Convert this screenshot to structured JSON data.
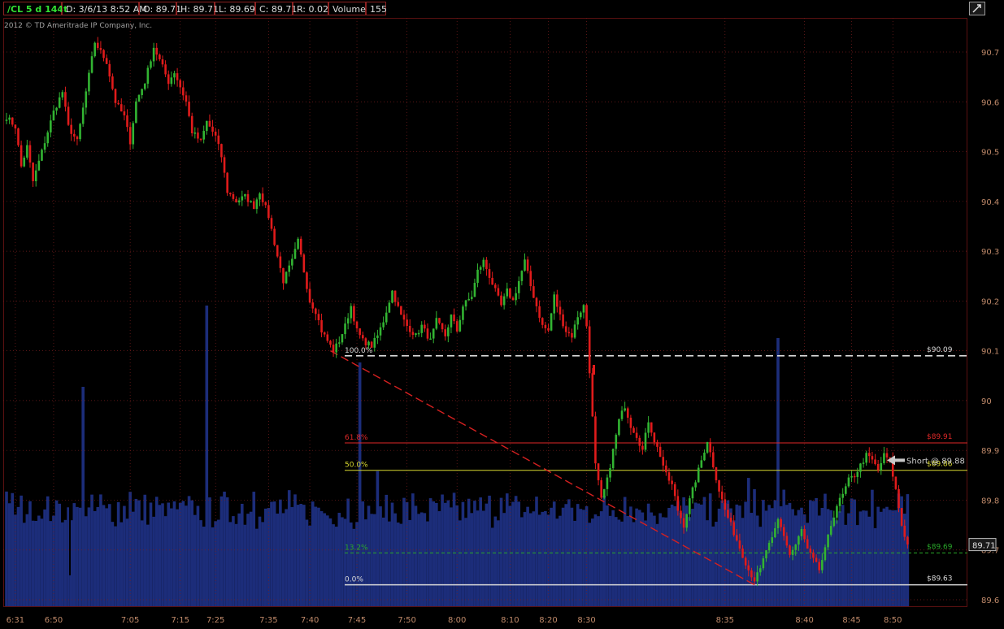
{
  "header": {
    "symbol": "/CL 5 d 144t",
    "date": "D: 3/6/13 8:52 AM",
    "open": "O: 89.71",
    "high": "H: 89.71",
    "low": "L: 89.69",
    "close": "C: 89.71",
    "range": "R: 0.02",
    "volume_label": "Volume",
    "volume_value": "155"
  },
  "copyright": "2012 © TD Ameritrade IP Company, Inc.",
  "colors": {
    "background": "#000000",
    "axis_text": "#c08a6a",
    "up": "#32b432",
    "down": "#e01b1b",
    "volume": "#1c2d7a",
    "fib_618": "#e02828",
    "fib_50": "#d8d830",
    "fib_132": "#2aa82a",
    "fib_100": "#d8d8d8",
    "trendline": "#d42020"
  },
  "chart_data": {
    "type": "candlestick",
    "y_ticks": [
      "90.7",
      "90.6",
      "90.5",
      "90.4",
      "90.3",
      "90.2",
      "90.1",
      "90",
      "89.9",
      "89.8",
      "89.7",
      "89.6"
    ],
    "ylim": [
      89.59,
      90.81
    ],
    "x_ticks": [
      "6:31",
      "6:50",
      "7:05",
      "7:15",
      "7:25",
      "7:35",
      "7:40",
      "7:45",
      "7:50",
      "8:00",
      "8:10",
      "8:20",
      "8:30",
      "8:35",
      "8:40",
      "8:45",
      "8:50"
    ],
    "x_tick_bars": [
      3,
      16,
      42,
      59,
      71,
      89,
      103,
      119,
      136,
      153,
      171,
      184,
      197,
      244,
      271,
      287,
      301
    ],
    "bar_count": 307,
    "anchors": [
      [
        0,
        90.57
      ],
      [
        3,
        90.55
      ],
      [
        5,
        90.47
      ],
      [
        7,
        90.51
      ],
      [
        9,
        90.44
      ],
      [
        13,
        90.52
      ],
      [
        16,
        90.58
      ],
      [
        19,
        90.62
      ],
      [
        21,
        90.55
      ],
      [
        24,
        90.52
      ],
      [
        27,
        90.62
      ],
      [
        30,
        90.72
      ],
      [
        34,
        90.68
      ],
      [
        37,
        90.6
      ],
      [
        40,
        90.57
      ],
      [
        42,
        90.52
      ],
      [
        44,
        90.6
      ],
      [
        47,
        90.64
      ],
      [
        50,
        90.71
      ],
      [
        53,
        90.67
      ],
      [
        55,
        90.64
      ],
      [
        57,
        90.66
      ],
      [
        59,
        90.63
      ],
      [
        61,
        90.6
      ],
      [
        63,
        90.54
      ],
      [
        66,
        90.52
      ],
      [
        68,
        90.56
      ],
      [
        71,
        90.53
      ],
      [
        73,
        90.49
      ],
      [
        75,
        90.42
      ],
      [
        78,
        90.4
      ],
      [
        81,
        90.41
      ],
      [
        84,
        90.39
      ],
      [
        86,
        90.42
      ],
      [
        89,
        90.37
      ],
      [
        92,
        90.29
      ],
      [
        94,
        90.24
      ],
      [
        97,
        90.28
      ],
      [
        99,
        90.32
      ],
      [
        101,
        90.26
      ],
      [
        103,
        90.2
      ],
      [
        105,
        90.18
      ],
      [
        107,
        90.14
      ],
      [
        109,
        90.12
      ],
      [
        111,
        90.1
      ],
      [
        113,
        90.12
      ],
      [
        115,
        90.15
      ],
      [
        117,
        90.19
      ],
      [
        119,
        90.14
      ],
      [
        121,
        90.12
      ],
      [
        124,
        90.11
      ],
      [
        126,
        90.13
      ],
      [
        128,
        90.16
      ],
      [
        131,
        90.22
      ],
      [
        134,
        90.17
      ],
      [
        136,
        90.15
      ],
      [
        139,
        90.13
      ],
      [
        141,
        90.15
      ],
      [
        144,
        90.12
      ],
      [
        146,
        90.16
      ],
      [
        149,
        90.13
      ],
      [
        151,
        90.17
      ],
      [
        153,
        90.14
      ],
      [
        155,
        90.19
      ],
      [
        158,
        90.21
      ],
      [
        160,
        90.26
      ],
      [
        162,
        90.28
      ],
      [
        164,
        90.25
      ],
      [
        166,
        90.22
      ],
      [
        168,
        90.19
      ],
      [
        170,
        90.22
      ],
      [
        172,
        90.2
      ],
      [
        174,
        90.24
      ],
      [
        176,
        90.28
      ],
      [
        178,
        90.23
      ],
      [
        180,
        90.19
      ],
      [
        182,
        90.15
      ],
      [
        184,
        90.14
      ],
      [
        186,
        90.21
      ],
      [
        188,
        90.17
      ],
      [
        190,
        90.14
      ],
      [
        192,
        90.13
      ],
      [
        194,
        90.17
      ],
      [
        196,
        90.19
      ],
      [
        197,
        90.15
      ],
      [
        198,
        90.06
      ],
      [
        200,
        89.87
      ],
      [
        202,
        89.8
      ],
      [
        204,
        89.84
      ],
      [
        206,
        89.9
      ],
      [
        208,
        89.96
      ],
      [
        210,
        89.99
      ],
      [
        212,
        89.95
      ],
      [
        214,
        89.93
      ],
      [
        216,
        89.9
      ],
      [
        218,
        89.96
      ],
      [
        220,
        89.92
      ],
      [
        222,
        89.89
      ],
      [
        224,
        89.85
      ],
      [
        226,
        89.83
      ],
      [
        228,
        89.78
      ],
      [
        230,
        89.75
      ],
      [
        232,
        89.8
      ],
      [
        234,
        89.84
      ],
      [
        236,
        89.88
      ],
      [
        238,
        89.92
      ],
      [
        240,
        89.87
      ],
      [
        242,
        89.82
      ],
      [
        244,
        89.78
      ],
      [
        246,
        89.75
      ],
      [
        248,
        89.72
      ],
      [
        250,
        89.69
      ],
      [
        252,
        89.66
      ],
      [
        254,
        89.64
      ],
      [
        256,
        89.66
      ],
      [
        258,
        89.7
      ],
      [
        260,
        89.72
      ],
      [
        262,
        89.76
      ],
      [
        264,
        89.73
      ],
      [
        266,
        89.69
      ],
      [
        268,
        89.71
      ],
      [
        270,
        89.74
      ],
      [
        272,
        89.7
      ],
      [
        274,
        89.68
      ],
      [
        276,
        89.66
      ],
      [
        278,
        89.7
      ],
      [
        280,
        89.75
      ],
      [
        282,
        89.79
      ],
      [
        284,
        89.81
      ],
      [
        286,
        89.84
      ],
      [
        288,
        89.85
      ],
      [
        290,
        89.87
      ],
      [
        292,
        89.89
      ],
      [
        294,
        89.88
      ],
      [
        296,
        89.86
      ],
      [
        298,
        89.89
      ],
      [
        300,
        89.88
      ],
      [
        302,
        89.82
      ],
      [
        304,
        89.75
      ],
      [
        306,
        89.71
      ]
    ],
    "volume_pct": [
      0.45,
      0.22,
      0.31,
      0.26,
      0.24,
      0.28,
      0.25,
      0.27,
      0.23,
      0.29,
      0.26,
      0.24,
      0.3,
      0.22,
      0.27,
      0.25,
      0.28,
      0.23,
      0.26,
      0.24,
      0.27,
      0.25,
      0.29,
      0.24,
      0.26,
      0.22,
      0.28,
      0.25,
      0.23,
      0.27,
      0.24,
      0.26,
      0.31,
      0.25,
      0.22,
      0.28,
      0.26,
      0.24,
      0.29,
      0.23,
      0.27,
      0.25
    ],
    "fibonacci": [
      {
        "label": "100.0%",
        "price": 90.09,
        "price_label": "$90.09",
        "color": "#d8d8d8",
        "style": "dashed"
      },
      {
        "label": "61.8%",
        "price": 89.915,
        "price_label": "$89.91",
        "color": "#e02828",
        "style": "solid"
      },
      {
        "label": "50.0%",
        "price": 89.86,
        "price_label": "$89.86",
        "color": "#d8d830",
        "style": "solid"
      },
      {
        "label": "13.2%",
        "price": 89.694,
        "price_label": "$89.69",
        "color": "#2aa82a",
        "style": "dashed"
      },
      {
        "label": "0.0%",
        "price": 89.63,
        "price_label": "$89.63",
        "color": "#d8d8d8",
        "style": "solid"
      }
    ],
    "trendline": {
      "from": [
        110,
        90.1
      ],
      "to": [
        254,
        89.63
      ]
    },
    "annotation": {
      "text": "Short @ 89.88",
      "price": 89.88,
      "bar": 299
    },
    "last_price": {
      "label": "89.71",
      "price": 89.71
    }
  }
}
